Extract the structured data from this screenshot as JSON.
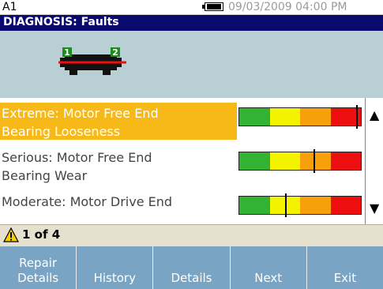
{
  "status": {
    "screen_id": "A1",
    "datetime": "09/03/2009 04:00 PM",
    "battery_icon": "battery-icon"
  },
  "title": "DIAGNOSIS: Faults",
  "diagram": {
    "point_1": "1",
    "point_2": "2",
    "icon": "motor-icon"
  },
  "faults": [
    {
      "text": "Extreme: Motor Free End\nBearing Looseness",
      "severity_level": 0.97,
      "selected": true
    },
    {
      "text": "Serious: Motor Free End\nBearing Wear",
      "severity_level": 0.62,
      "selected": false
    },
    {
      "text": "Moderate: Motor Drive End",
      "severity_level": 0.38,
      "selected": false
    }
  ],
  "severity_scale": [
    "#33b233",
    "#f3f300",
    "#f8a009",
    "#ee1010"
  ],
  "scroll": {
    "up_icon": "scroll-up-icon",
    "down_icon": "scroll-down-icon"
  },
  "count": {
    "text": "1 of 4",
    "icon": "warning-icon"
  },
  "softkeys": [
    {
      "label": "Repair\nDetails"
    },
    {
      "label": "History"
    },
    {
      "label": "Details"
    },
    {
      "label": "Next"
    },
    {
      "label": "Exit"
    }
  ]
}
